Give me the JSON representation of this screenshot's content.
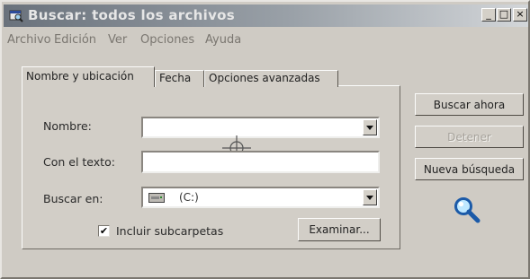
{
  "window": {
    "title": "Buscar: todos los archivos",
    "controls": {
      "minimize": "_",
      "maximize": "□",
      "close": "×"
    }
  },
  "menu": [
    "Archivo",
    "Edición",
    "Ver",
    "Opciones",
    "Ayuda"
  ],
  "tabs": [
    {
      "label": "Nombre y ubicación",
      "active": true
    },
    {
      "label": "Fecha",
      "active": false
    },
    {
      "label": "Opciones avanzadas",
      "active": false
    }
  ],
  "form": {
    "name_label": "Nombre:",
    "name_value": "",
    "text_label": "Con el texto:",
    "text_value": "",
    "look_in_label": "Buscar en:",
    "look_in_value": "(C:)",
    "subfolders_label": "Incluir subcarpetas",
    "subfolders_checked": "✔",
    "browse_label": "Examinar..."
  },
  "actions": {
    "search_now": "Buscar ahora",
    "stop": "Detener",
    "new_search": "Nueva búsqueda"
  },
  "icons": {
    "app": "search-window-icon",
    "magnifier": "magnifier-icon",
    "drive": "drive-icon",
    "cursor": "crosshair-icon"
  }
}
